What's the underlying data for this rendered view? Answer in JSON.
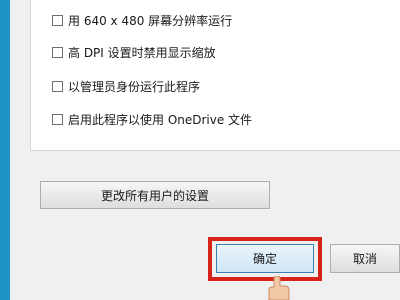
{
  "options": [
    {
      "label": "用 640 x 480 屏幕分辨率运行",
      "checked": false
    },
    {
      "label": "高 DPI 设置时禁用显示缩放",
      "checked": false
    },
    {
      "label": "以管理员身份运行此程序",
      "checked": false
    },
    {
      "label": "启用此程序以使用 OneDrive 文件",
      "checked": false
    }
  ],
  "buttons": {
    "change_all_users": "更改所有用户的设置",
    "ok": "确定",
    "cancel": "取消"
  },
  "colors": {
    "desktop": "#1f93c6",
    "highlight": "#d7221c"
  }
}
